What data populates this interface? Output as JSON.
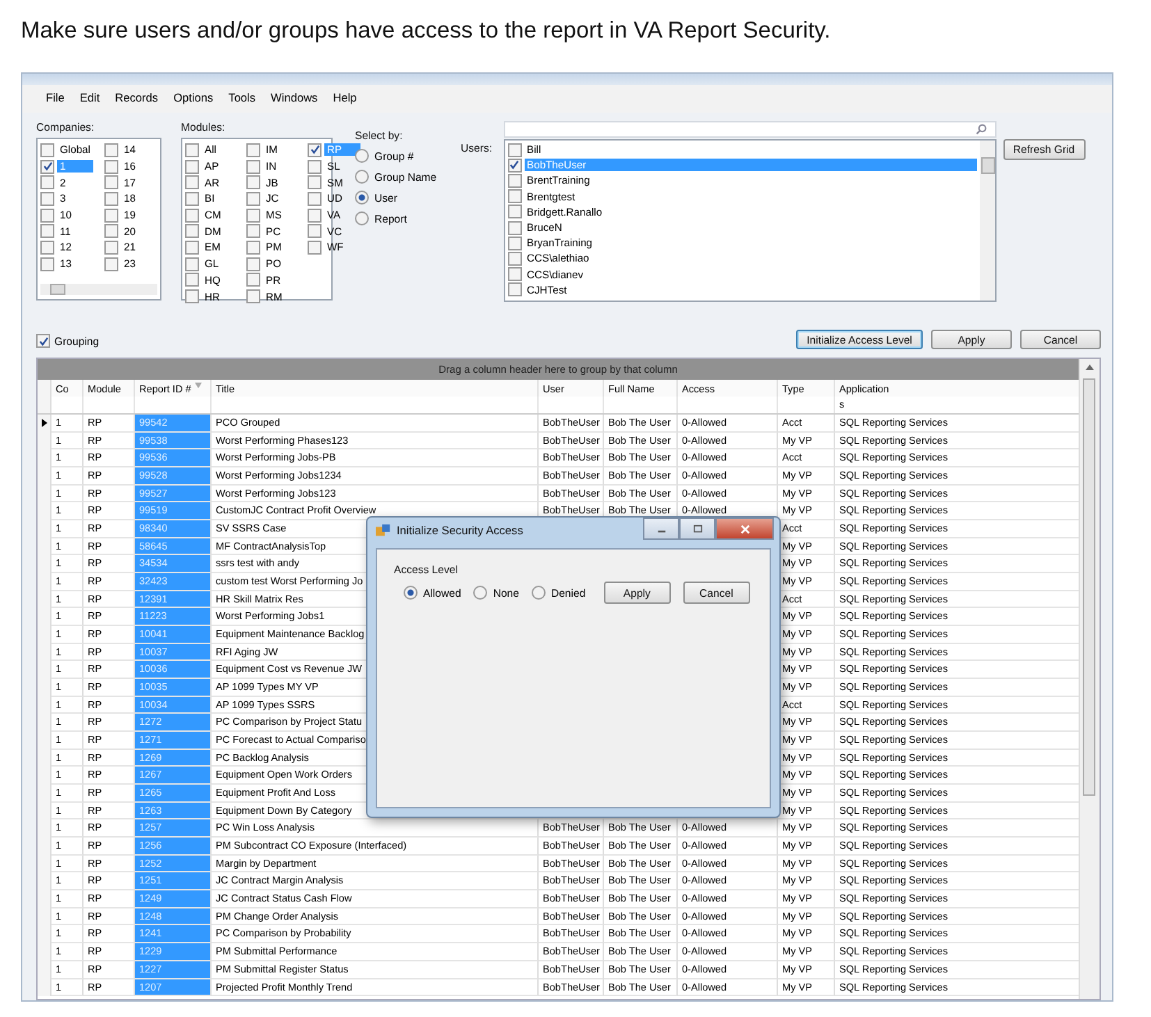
{
  "instruction": "Make sure users and/or groups have access to the report in VA Report Security.",
  "menu": [
    "File",
    "Edit",
    "Records",
    "Options",
    "Tools",
    "Windows",
    "Help"
  ],
  "companies": {
    "label": "Companies:",
    "items": [
      {
        "label": "Global",
        "checked": false,
        "selected": false
      },
      {
        "label": "1",
        "checked": true,
        "selected": true
      },
      {
        "label": "2",
        "checked": false,
        "selected": false
      },
      {
        "label": "3",
        "checked": false,
        "selected": false
      },
      {
        "label": "10",
        "checked": false,
        "selected": false
      },
      {
        "label": "11",
        "checked": false,
        "selected": false
      },
      {
        "label": "12",
        "checked": false,
        "selected": false
      },
      {
        "label": "13",
        "checked": false,
        "selected": false
      },
      {
        "label": "14",
        "checked": false,
        "selected": false
      },
      {
        "label": "16",
        "checked": false,
        "selected": false
      },
      {
        "label": "17",
        "checked": false,
        "selected": false
      },
      {
        "label": "18",
        "checked": false,
        "selected": false
      },
      {
        "label": "19",
        "checked": false,
        "selected": false
      },
      {
        "label": "20",
        "checked": false,
        "selected": false
      },
      {
        "label": "21",
        "checked": false,
        "selected": false
      },
      {
        "label": "23",
        "checked": false,
        "selected": false
      }
    ]
  },
  "modules": {
    "label": "Modules:",
    "items": [
      {
        "label": "All",
        "checked": false,
        "selected": false
      },
      {
        "label": "AP",
        "checked": false,
        "selected": false
      },
      {
        "label": "AR",
        "checked": false,
        "selected": false
      },
      {
        "label": "BI",
        "checked": false,
        "selected": false
      },
      {
        "label": "CM",
        "checked": false,
        "selected": false
      },
      {
        "label": "DM",
        "checked": false,
        "selected": false
      },
      {
        "label": "EM",
        "checked": false,
        "selected": false
      },
      {
        "label": "GL",
        "checked": false,
        "selected": false
      },
      {
        "label": "HQ",
        "checked": false,
        "selected": false
      },
      {
        "label": "HR",
        "checked": false,
        "selected": false
      },
      {
        "label": "IM",
        "checked": false,
        "selected": false
      },
      {
        "label": "IN",
        "checked": false,
        "selected": false
      },
      {
        "label": "JB",
        "checked": false,
        "selected": false
      },
      {
        "label": "JC",
        "checked": false,
        "selected": false
      },
      {
        "label": "MS",
        "checked": false,
        "selected": false
      },
      {
        "label": "PC",
        "checked": false,
        "selected": false
      },
      {
        "label": "PM",
        "checked": false,
        "selected": false
      },
      {
        "label": "PO",
        "checked": false,
        "selected": false
      },
      {
        "label": "PR",
        "checked": false,
        "selected": false
      },
      {
        "label": "RM",
        "checked": false,
        "selected": false
      },
      {
        "label": "RP",
        "checked": true,
        "selected": true
      },
      {
        "label": "SL",
        "checked": false,
        "selected": false
      },
      {
        "label": "SM",
        "checked": false,
        "selected": false
      },
      {
        "label": "UD",
        "checked": false,
        "selected": false
      },
      {
        "label": "VA",
        "checked": false,
        "selected": false
      },
      {
        "label": "VC",
        "checked": false,
        "selected": false
      },
      {
        "label": "WF",
        "checked": false,
        "selected": false
      }
    ]
  },
  "select_by": {
    "label": "Select by:",
    "options": [
      {
        "label": "Group #",
        "selected": false
      },
      {
        "label": "Group Name",
        "selected": false
      },
      {
        "label": "User",
        "selected": true
      },
      {
        "label": "Report",
        "selected": false
      }
    ]
  },
  "users": {
    "label": "Users:",
    "items": [
      {
        "label": "Bill",
        "checked": false,
        "selected": false
      },
      {
        "label": "BobTheUser",
        "checked": true,
        "selected": true
      },
      {
        "label": "BrentTraining",
        "checked": false,
        "selected": false
      },
      {
        "label": "Brentgtest",
        "checked": false,
        "selected": false
      },
      {
        "label": "Bridgett.Ranallo",
        "checked": false,
        "selected": false
      },
      {
        "label": "BruceN",
        "checked": false,
        "selected": false
      },
      {
        "label": "BryanTraining",
        "checked": false,
        "selected": false
      },
      {
        "label": "CCS\\alethiao",
        "checked": false,
        "selected": false
      },
      {
        "label": "CCS\\dianev",
        "checked": false,
        "selected": false
      },
      {
        "label": "CJHTest",
        "checked": false,
        "selected": false
      }
    ]
  },
  "refresh_button": "Refresh Grid",
  "grouping": {
    "label": "Grouping",
    "checked": true
  },
  "actions": [
    {
      "label": "Initialize Access Level",
      "focused": true
    },
    {
      "label": "Apply",
      "focused": false
    },
    {
      "label": "Cancel",
      "focused": false
    }
  ],
  "group_panel": "Drag a column header here to group by that column",
  "columns": [
    {
      "label": "Co",
      "sorted": false,
      "selected": false
    },
    {
      "label": "Module",
      "sorted": false,
      "selected": false
    },
    {
      "label": "Report ID #",
      "sorted": true,
      "selected": true
    },
    {
      "label": "Title",
      "sorted": false,
      "selected": false
    },
    {
      "label": "User",
      "sorted": false,
      "selected": false
    },
    {
      "label": "Full Name",
      "sorted": false,
      "selected": false
    },
    {
      "label": "Access",
      "sorted": false,
      "selected": false
    },
    {
      "label": "Type",
      "sorted": false,
      "selected": false
    },
    {
      "label": "Application",
      "sorted": false,
      "selected": false,
      "filter": "s"
    }
  ],
  "rows": [
    {
      "current": true,
      "co": "1",
      "module": "RP",
      "report_id": "99542",
      "title": "PCO Grouped",
      "user": "BobTheUser",
      "full_name": "Bob The User",
      "access": "0-Allowed",
      "type": "Acct",
      "application": "SQL Reporting Services"
    },
    {
      "current": false,
      "co": "1",
      "module": "RP",
      "report_id": "99538",
      "title": "Worst Performing Phases123",
      "user": "BobTheUser",
      "full_name": "Bob The User",
      "access": "0-Allowed",
      "type": "My VP",
      "application": "SQL Reporting Services"
    },
    {
      "current": false,
      "co": "1",
      "module": "RP",
      "report_id": "99536",
      "title": "Worst Performing Jobs-PB",
      "user": "BobTheUser",
      "full_name": "Bob The User",
      "access": "0-Allowed",
      "type": "Acct",
      "application": "SQL Reporting Services"
    },
    {
      "current": false,
      "co": "1",
      "module": "RP",
      "report_id": "99528",
      "title": "Worst Performing Jobs1234",
      "user": "BobTheUser",
      "full_name": "Bob The User",
      "access": "0-Allowed",
      "type": "My VP",
      "application": "SQL Reporting Services"
    },
    {
      "current": false,
      "co": "1",
      "module": "RP",
      "report_id": "99527",
      "title": "Worst Performing Jobs123",
      "user": "BobTheUser",
      "full_name": "Bob The User",
      "access": "0-Allowed",
      "type": "My VP",
      "application": "SQL Reporting Services"
    },
    {
      "current": false,
      "co": "1",
      "module": "RP",
      "report_id": "99519",
      "title": "CustomJC Contract Profit Overview",
      "user": "BobTheUser",
      "full_name": "Bob The User",
      "access": "0-Allowed",
      "type": "My VP",
      "application": "SQL Reporting Services"
    },
    {
      "current": false,
      "co": "1",
      "module": "RP",
      "report_id": "98340",
      "title": "SV SSRS Case",
      "type": "Acct",
      "application": "SQL Reporting Services"
    },
    {
      "current": false,
      "co": "1",
      "module": "RP",
      "report_id": "58645",
      "title": "MF ContractAnalysisTop",
      "type": "My VP",
      "application": "SQL Reporting Services"
    },
    {
      "current": false,
      "co": "1",
      "module": "RP",
      "report_id": "34534",
      "title": "ssrs test with andy",
      "type": "My VP",
      "application": "SQL Reporting Services"
    },
    {
      "current": false,
      "co": "1",
      "module": "RP",
      "report_id": "32423",
      "title": "custom test Worst Performing Jo",
      "type": "My VP",
      "application": "SQL Reporting Services"
    },
    {
      "current": false,
      "co": "1",
      "module": "RP",
      "report_id": "12391",
      "title": "HR Skill Matrix Res",
      "type": "Acct",
      "application": "SQL Reporting Services"
    },
    {
      "current": false,
      "co": "1",
      "module": "RP",
      "report_id": "11223",
      "title": "Worst Performing Jobs1",
      "type": "My VP",
      "application": "SQL Reporting Services"
    },
    {
      "current": false,
      "co": "1",
      "module": "RP",
      "report_id": "10041",
      "title": "Equipment Maintenance Backlog",
      "type": "My VP",
      "application": "SQL Reporting Services"
    },
    {
      "current": false,
      "co": "1",
      "module": "RP",
      "report_id": "10037",
      "title": "RFI Aging JW",
      "type": "My VP",
      "application": "SQL Reporting Services"
    },
    {
      "current": false,
      "co": "1",
      "module": "RP",
      "report_id": "10036",
      "title": "Equipment Cost vs Revenue JW",
      "type": "My VP",
      "application": "SQL Reporting Services"
    },
    {
      "current": false,
      "co": "1",
      "module": "RP",
      "report_id": "10035",
      "title": "AP 1099 Types MY VP",
      "type": "My VP",
      "application": "SQL Reporting Services"
    },
    {
      "current": false,
      "co": "1",
      "module": "RP",
      "report_id": "10034",
      "title": "AP 1099 Types SSRS",
      "type": "Acct",
      "application": "SQL Reporting Services"
    },
    {
      "current": false,
      "co": "1",
      "module": "RP",
      "report_id": "1272",
      "title": "PC Comparison by Project Statu",
      "type": "My VP",
      "application": "SQL Reporting Services"
    },
    {
      "current": false,
      "co": "1",
      "module": "RP",
      "report_id": "1271",
      "title": "PC Forecast to Actual Compariso",
      "type": "My VP",
      "application": "SQL Reporting Services"
    },
    {
      "current": false,
      "co": "1",
      "module": "RP",
      "report_id": "1269",
      "title": "PC Backlog Analysis",
      "type": "My VP",
      "application": "SQL Reporting Services"
    },
    {
      "current": false,
      "co": "1",
      "module": "RP",
      "report_id": "1267",
      "title": "Equipment Open Work Orders",
      "type": "My VP",
      "application": "SQL Reporting Services"
    },
    {
      "current": false,
      "co": "1",
      "module": "RP",
      "report_id": "1265",
      "title": "Equipment Profit And Loss",
      "type": "My VP",
      "application": "SQL Reporting Services"
    },
    {
      "current": false,
      "co": "1",
      "module": "RP",
      "report_id": "1263",
      "title": "Equipment Down By Category",
      "type": "My VP",
      "application": "SQL Reporting Services"
    },
    {
      "current": false,
      "co": "1",
      "module": "RP",
      "report_id": "1257",
      "title": "PC Win Loss Analysis",
      "user": "BobTheUser",
      "full_name": "Bob The User",
      "access": "0-Allowed",
      "type": "My VP",
      "application": "SQL Reporting Services"
    },
    {
      "current": false,
      "co": "1",
      "module": "RP",
      "report_id": "1256",
      "title": "PM Subcontract CO Exposure (Interfaced)",
      "user": "BobTheUser",
      "full_name": "Bob The User",
      "access": "0-Allowed",
      "type": "My VP",
      "application": "SQL Reporting Services"
    },
    {
      "current": false,
      "co": "1",
      "module": "RP",
      "report_id": "1252",
      "title": "Margin by Department",
      "user": "BobTheUser",
      "full_name": "Bob The User",
      "access": "0-Allowed",
      "type": "My VP",
      "application": "SQL Reporting Services"
    },
    {
      "current": false,
      "co": "1",
      "module": "RP",
      "report_id": "1251",
      "title": "JC Contract Margin Analysis",
      "user": "BobTheUser",
      "full_name": "Bob The User",
      "access": "0-Allowed",
      "type": "My VP",
      "application": "SQL Reporting Services"
    },
    {
      "current": false,
      "co": "1",
      "module": "RP",
      "report_id": "1249",
      "title": "JC Contract Status Cash Flow",
      "user": "BobTheUser",
      "full_name": "Bob The User",
      "access": "0-Allowed",
      "type": "My VP",
      "application": "SQL Reporting Services"
    },
    {
      "current": false,
      "co": "1",
      "module": "RP",
      "report_id": "1248",
      "title": "PM Change Order Analysis",
      "user": "BobTheUser",
      "full_name": "Bob The User",
      "access": "0-Allowed",
      "type": "My VP",
      "application": "SQL Reporting Services"
    },
    {
      "current": false,
      "co": "1",
      "module": "RP",
      "report_id": "1241",
      "title": "PC Comparison by Probability",
      "user": "BobTheUser",
      "full_name": "Bob The User",
      "access": "0-Allowed",
      "type": "My VP",
      "application": "SQL Reporting Services"
    },
    {
      "current": false,
      "co": "1",
      "module": "RP",
      "report_id": "1229",
      "title": "PM Submittal Performance",
      "user": "BobTheUser",
      "full_name": "Bob The User",
      "access": "0-Allowed",
      "type": "My VP",
      "application": "SQL Reporting Services"
    },
    {
      "current": false,
      "co": "1",
      "module": "RP",
      "report_id": "1227",
      "title": "PM Submittal Register Status",
      "user": "BobTheUser",
      "full_name": "Bob The User",
      "access": "0-Allowed",
      "type": "My VP",
      "application": "SQL Reporting Services"
    },
    {
      "current": false,
      "co": "1",
      "module": "RP",
      "report_id": "1207",
      "title": "Projected Profit Monthly Trend",
      "user": "BobTheUser",
      "full_name": "Bob The User",
      "access": "0-Allowed",
      "type": "My VP",
      "application": "SQL Reporting Services"
    }
  ],
  "dialog": {
    "title": "Initialize Security Access",
    "group_label": "Access Level",
    "options": [
      {
        "label": "Allowed",
        "selected": true
      },
      {
        "label": "None",
        "selected": false
      },
      {
        "label": "Denied",
        "selected": false
      }
    ],
    "buttons": [
      "Apply",
      "Cancel"
    ]
  }
}
